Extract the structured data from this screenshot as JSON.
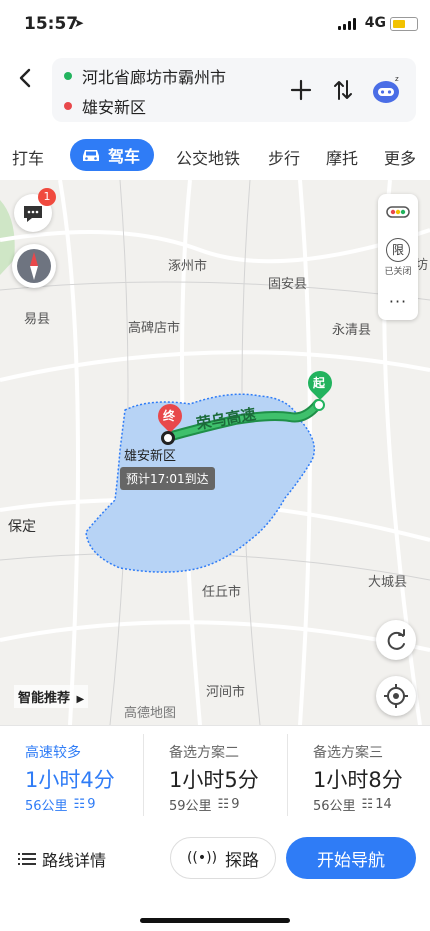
{
  "status_bar": {
    "time": "15:57",
    "network": "4G"
  },
  "route": {
    "origin": "河北省廊坊市霸州市",
    "destination": "雄安新区"
  },
  "mode_tabs": [
    {
      "label": "打车"
    },
    {
      "label": "驾车"
    },
    {
      "label": "公交地铁"
    },
    {
      "label": "步行"
    },
    {
      "label": "摩托"
    },
    {
      "label": "更多"
    }
  ],
  "map": {
    "message_badge": "1",
    "restriction": {
      "icon_char": "限",
      "status": "已关闭"
    },
    "places": [
      "涿州市",
      "固安县",
      "易县",
      "高碑店市",
      "永清县",
      "保定",
      "任丘市",
      "大城县",
      "河间市",
      "坊"
    ],
    "route_road": "荣乌高速",
    "start_marker": "起",
    "end_marker": "终",
    "destination_label": "雄安新区",
    "eta": "预计17:01到达",
    "smart_recommend": "智能推荐",
    "logo": "高德地图"
  },
  "plans": [
    {
      "title": "高速较多",
      "duration": "1小时4分",
      "distance": "56公里",
      "lights": "9"
    },
    {
      "title": "备选方案二",
      "duration": "1小时5分",
      "distance": "59公里",
      "lights": "9"
    },
    {
      "title": "备选方案三",
      "duration": "1小时8分",
      "distance": "56公里",
      "lights": "14"
    }
  ],
  "bottom": {
    "details": "路线详情",
    "explore": "探路",
    "start": "开始导航"
  },
  "colors": {
    "accent": "#2f7cf6",
    "route": "#22b35e",
    "area": "#b7d3f5"
  }
}
